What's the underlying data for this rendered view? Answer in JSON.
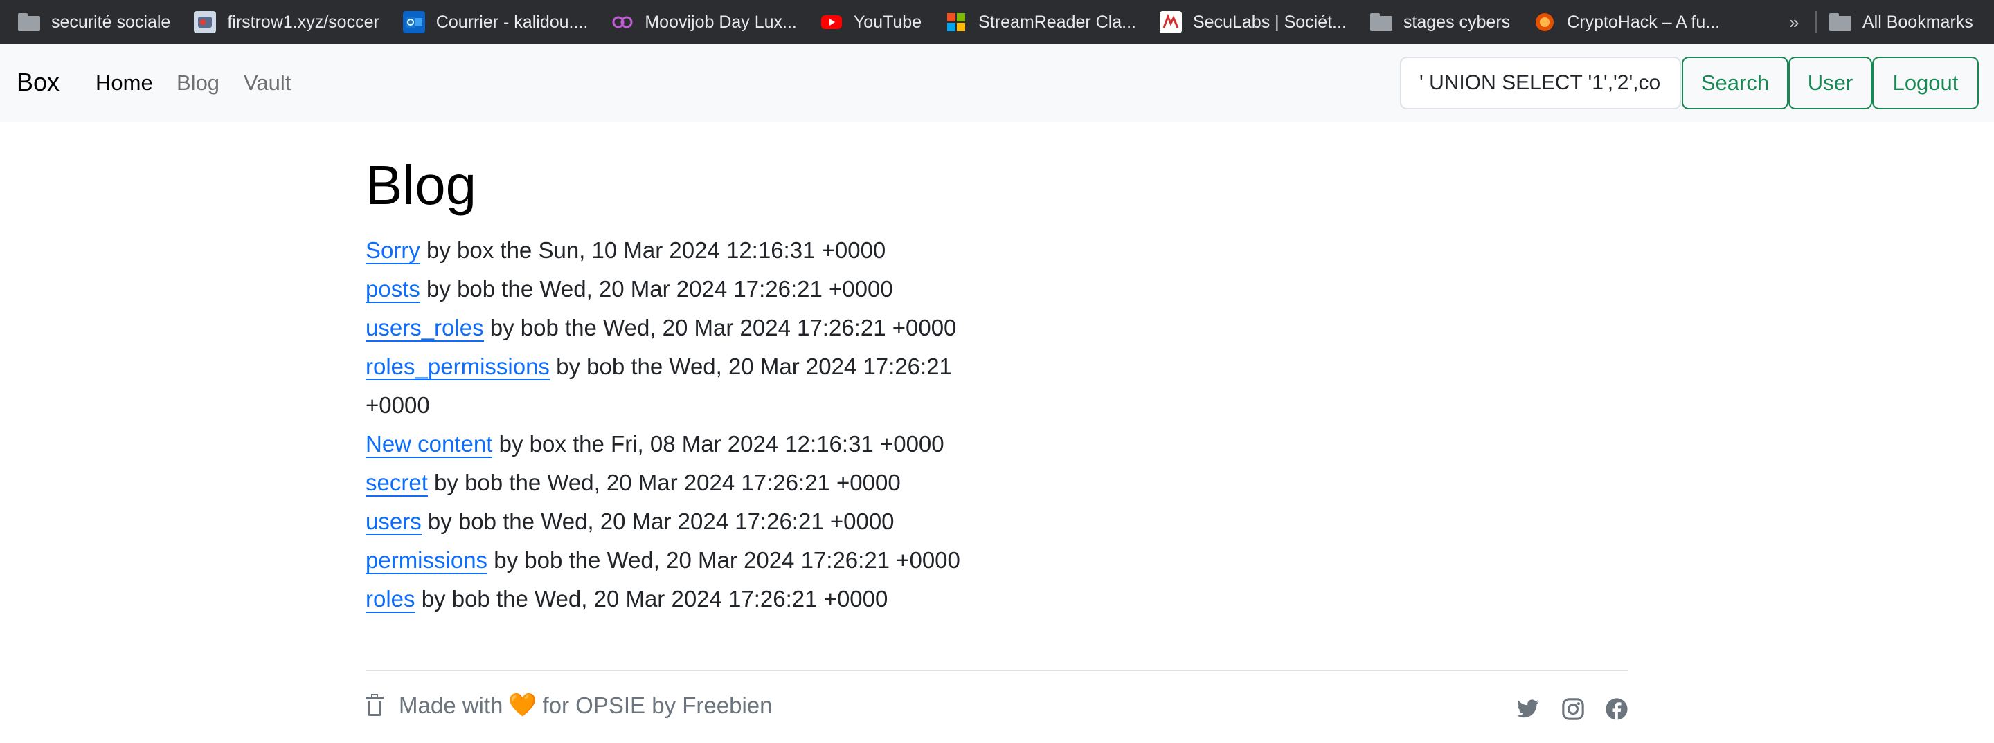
{
  "bookmarks": [
    {
      "label": "securité sociale",
      "icon": "folder-icon"
    },
    {
      "label": "firstrow1.xyz/soccer",
      "icon": "site-favicon"
    },
    {
      "label": "Courrier - kalidou....",
      "icon": "outlook-icon"
    },
    {
      "label": "Moovijob Day Lux...",
      "icon": "moovijob-icon"
    },
    {
      "label": "YouTube",
      "icon": "youtube-icon"
    },
    {
      "label": "StreamReader Cla...",
      "icon": "microsoft-icon"
    },
    {
      "label": "SecuLabs | Sociét...",
      "icon": "seculabs-icon"
    },
    {
      "label": "stages cybers",
      "icon": "folder-icon"
    },
    {
      "label": "CryptoHack – A fu...",
      "icon": "cryptohack-icon"
    }
  ],
  "bookmarks_more": "»",
  "bookmarks_all": "All Bookmarks",
  "navbar": {
    "brand": "Box",
    "links": [
      "Home",
      "Blog",
      "Vault"
    ],
    "search_value": "' UNION SELECT '1','2',co",
    "search_button": "Search",
    "user_button": "User",
    "logout_button": "Logout"
  },
  "page": {
    "title": "Blog",
    "posts": [
      {
        "title": "Sorry",
        "meta": "by box the Sun, 10 Mar 2024 12:16:31 +0000"
      },
      {
        "title": "posts",
        "meta": "by bob the Wed, 20 Mar 2024 17:26:21 +0000"
      },
      {
        "title": "users_roles",
        "meta": "by bob the Wed, 20 Mar 2024 17:26:21 +0000"
      },
      {
        "title": "roles_permissions",
        "meta": "by bob the Wed, 20 Mar 2024 17:26:21 +0000"
      },
      {
        "title": "New content",
        "meta": "by box the Fri, 08 Mar 2024 12:16:31 +0000"
      },
      {
        "title": "secret",
        "meta": "by bob the Wed, 20 Mar 2024 17:26:21 +0000"
      },
      {
        "title": "users",
        "meta": "by bob the Wed, 20 Mar 2024 17:26:21 +0000"
      },
      {
        "title": "permissions",
        "meta": "by bob the Wed, 20 Mar 2024 17:26:21 +0000"
      },
      {
        "title": "roles",
        "meta": "by bob the Wed, 20 Mar 2024 17:26:21 +0000"
      }
    ]
  },
  "footer": {
    "made_with": "Made with",
    "heart": "🧡",
    "credit": "for OPSIE by Freebien",
    "social": [
      "twitter-icon",
      "instagram-icon",
      "facebook-icon"
    ]
  },
  "colors": {
    "link": "#0d6efd",
    "button_outline": "#198754",
    "bookmarks_bg": "#2b2d31",
    "navbar_bg": "#f8f9fa"
  }
}
